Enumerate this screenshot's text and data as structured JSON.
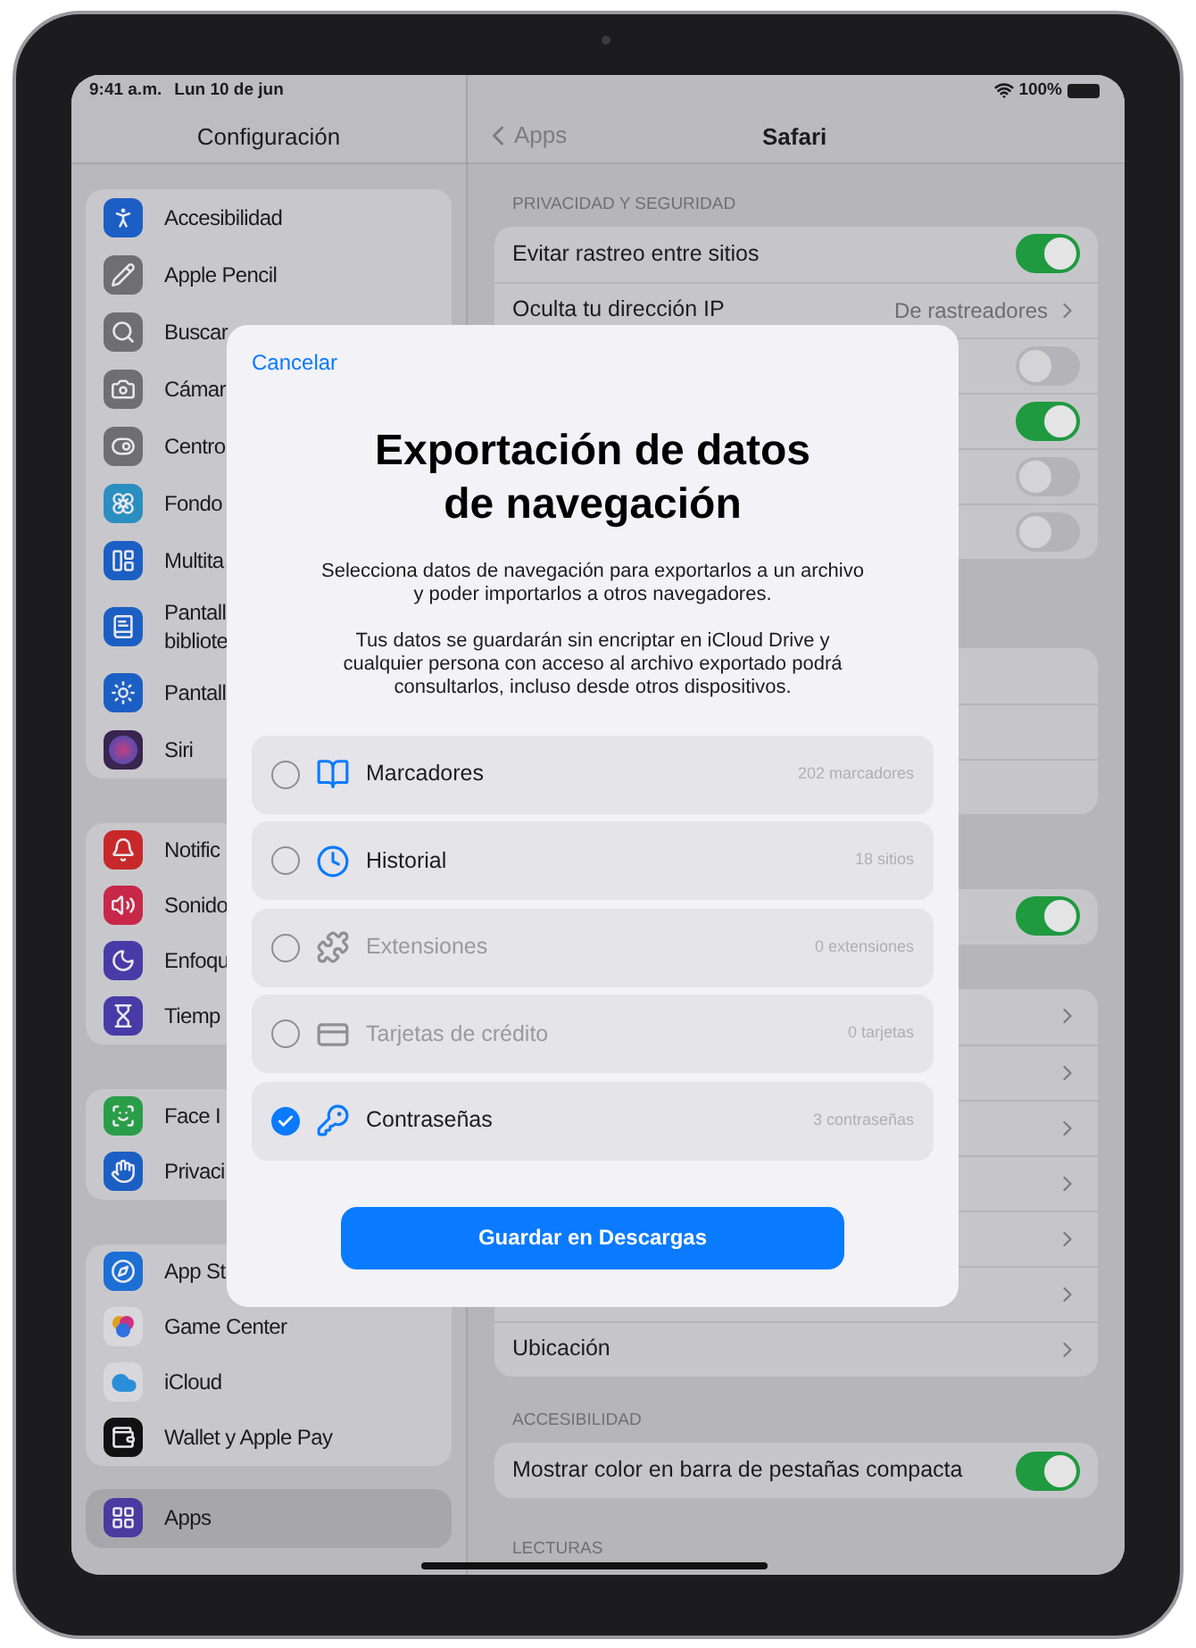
{
  "status_bar": {
    "time": "9:41 a.m.",
    "date": "Lun 10 de jun",
    "battery": "100%"
  },
  "sidebar": {
    "title": "Configuración",
    "groups": [
      {
        "items": [
          {
            "label": "Accesibilidad",
            "selected": false
          },
          {
            "label": "Apple Pencil",
            "selected": false
          },
          {
            "label": "Buscar",
            "selected": false
          },
          {
            "label": "Cámar",
            "selected": false
          },
          {
            "label": "Centro",
            "selected": false
          },
          {
            "label": "Fondo",
            "selected": false
          },
          {
            "label": "Multita",
            "selected": false
          },
          {
            "label": "Pantall\nbibliote",
            "selected": false
          },
          {
            "label": "Pantall",
            "selected": false
          },
          {
            "label": "Siri",
            "selected": false
          }
        ]
      },
      {
        "items": [
          {
            "label": "Notific",
            "selected": false
          },
          {
            "label": "Sonido",
            "selected": false
          },
          {
            "label": "Enfoqu",
            "selected": false
          },
          {
            "label": "Tiemp",
            "selected": false
          }
        ]
      },
      {
        "items": [
          {
            "label": "Face I",
            "selected": false
          },
          {
            "label": "Privaci",
            "selected": false
          }
        ]
      },
      {
        "items": [
          {
            "label": "App St",
            "selected": false
          },
          {
            "label": "Game Center",
            "selected": false
          },
          {
            "label": "iCloud",
            "selected": false
          },
          {
            "label": "Wallet y Apple Pay",
            "selected": false
          }
        ]
      },
      {
        "items": [
          {
            "label": "Apps",
            "selected": true
          }
        ]
      }
    ]
  },
  "detail": {
    "back": "Apps",
    "title": "Safari",
    "groups": [
      {
        "header": "PRIVACIDAD Y SEGURIDAD",
        "rows": [
          {
            "kind": "toggle",
            "label": "Evitar rastreo entre sitios",
            "on": true
          },
          {
            "kind": "link",
            "label": "Oculta tu dirección IP",
            "value": "De rastreadores"
          },
          {
            "kind": "toggle",
            "on": false
          },
          {
            "kind": "toggle",
            "on": true
          },
          {
            "kind": "toggle",
            "on": false
          },
          {
            "kind": "toggle",
            "on": false
          }
        ]
      },
      {
        "rows": [
          {
            "kind": "blank"
          },
          {
            "kind": "blank"
          },
          {
            "kind": "blank"
          }
        ]
      },
      {
        "rows": [
          {
            "kind": "toggle",
            "on": true
          }
        ]
      },
      {
        "rows": [
          {
            "kind": "link"
          },
          {
            "kind": "link"
          },
          {
            "kind": "link"
          },
          {
            "kind": "link"
          },
          {
            "kind": "link"
          },
          {
            "kind": "link"
          },
          {
            "kind": "link",
            "label": "Ubicación"
          }
        ]
      },
      {
        "header": "ACCESIBILIDAD",
        "rows": [
          {
            "kind": "toggle",
            "label": "Mostrar color en barra de pestañas compacta",
            "on": true
          }
        ]
      },
      {
        "header": "LECTURAS"
      }
    ]
  },
  "dialog": {
    "cancel": "Cancelar",
    "title": "Exportación de datos\nde navegación",
    "paragraphs": [
      "Selecciona datos de navegación para exportarlos a un archivo\ny poder importarlos a otros navegadores.",
      "Tus datos se guardarán sin encriptar en iCloud Drive y\ncualquier persona con acceso al archivo exportado podrá\nconsultarlos, incluso desde otros dispositivos."
    ],
    "options": [
      {
        "label": "Marcadores",
        "count": "202 marcadores",
        "checked": false,
        "disabled": false
      },
      {
        "label": "Historial",
        "count": "18 sitios",
        "checked": false,
        "disabled": false
      },
      {
        "label": "Extensiones",
        "count": "0 extensiones",
        "checked": false,
        "disabled": true
      },
      {
        "label": "Tarjetas de crédito",
        "count": "0 tarjetas",
        "checked": false,
        "disabled": true
      },
      {
        "label": "Contraseñas",
        "count": "3 contraseñas",
        "checked": true,
        "disabled": false
      }
    ],
    "button": "Guardar en Descargas"
  }
}
